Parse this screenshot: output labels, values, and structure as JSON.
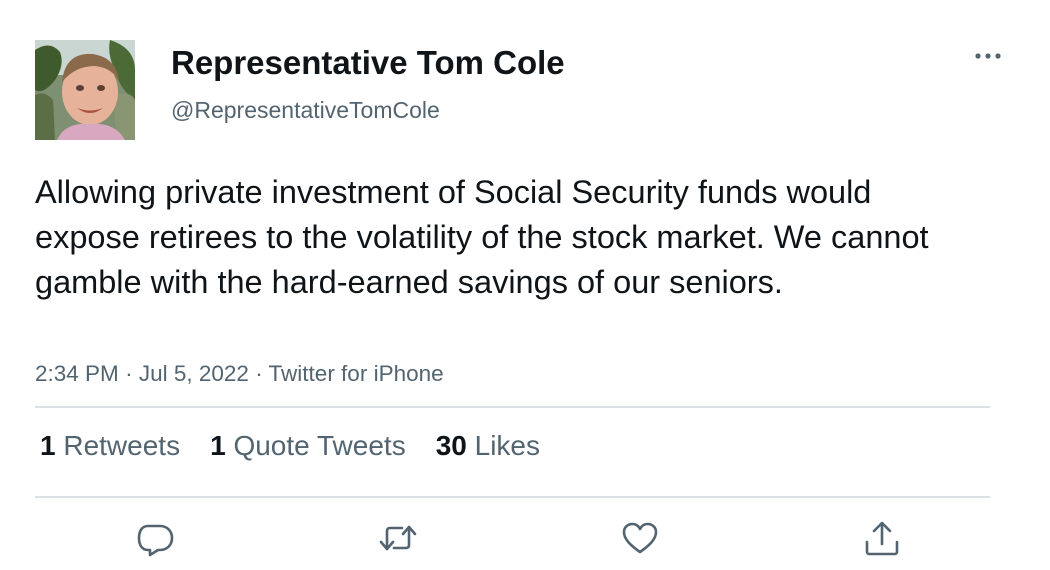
{
  "author": {
    "display_name": "Representative Tom Cole",
    "handle": "@RepresentativeTomCole"
  },
  "tweet": {
    "text": "Allowing private investment of Social Security funds would expose retirees to the volatility of the stock market. We cannot gamble with the hard-earned savings of our seniors.",
    "time": "2:34 PM",
    "date": "Jul 5, 2022",
    "source": "Twitter for iPhone",
    "separator": "·"
  },
  "stats": {
    "retweets_count": "1",
    "retweets_label": "Retweets",
    "quotes_count": "1",
    "quotes_label": "Quote Tweets",
    "likes_count": "30",
    "likes_label": "Likes"
  },
  "icons": {
    "more": "more-horizontal-icon",
    "reply": "reply-icon",
    "retweet": "retweet-icon",
    "like": "heart-icon",
    "share": "share-icon"
  },
  "colors": {
    "text": "#0f1419",
    "secondary": "#536471",
    "divider": "#dbe0e4"
  }
}
